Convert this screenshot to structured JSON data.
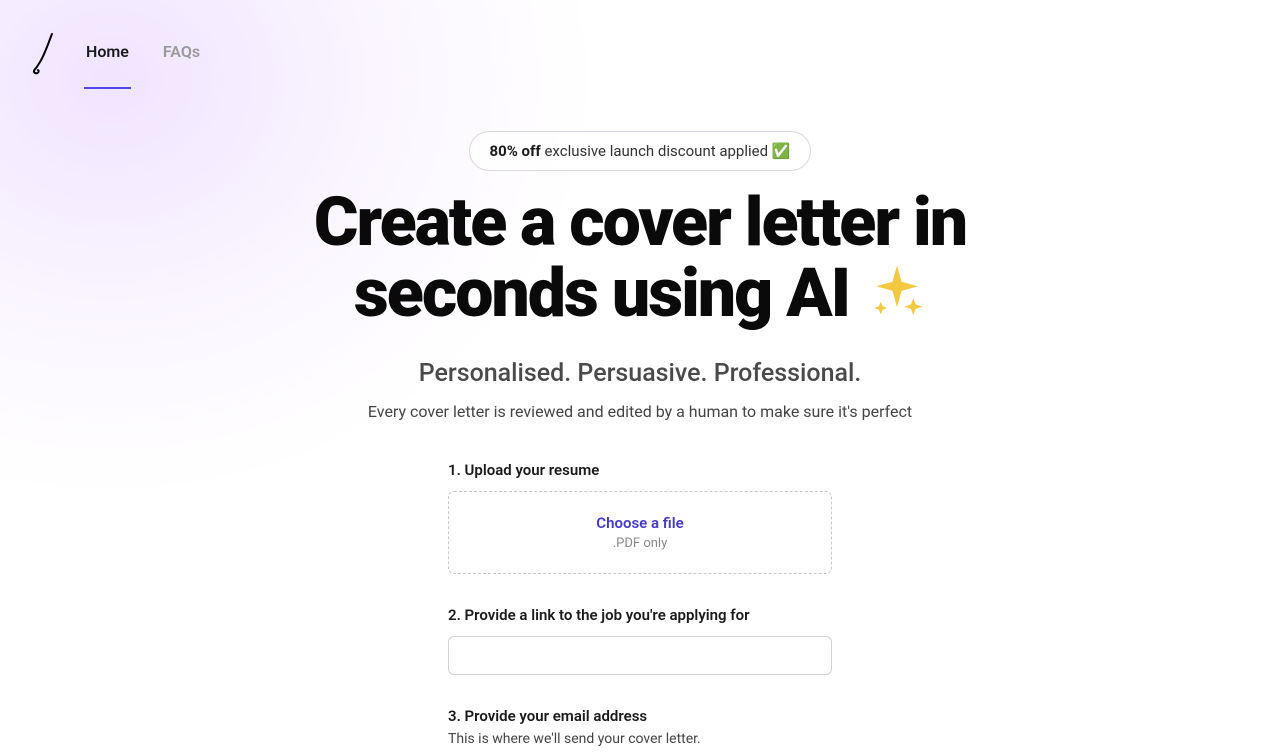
{
  "nav": {
    "home": "Home",
    "faqs": "FAQs"
  },
  "discount": {
    "bold": "80% off",
    "rest": " exclusive launch discount applied ✅"
  },
  "hero": {
    "title_prefix": "Create a cover letter in seconds using AI ",
    "subtitle": "Personalised. Persuasive. Professional.",
    "tagline": "Every cover letter is reviewed and edited by a human to make sure it's perfect"
  },
  "form": {
    "step1": {
      "label": "1. Upload your resume",
      "choose": "Choose a file",
      "hint": ".PDF only"
    },
    "step2": {
      "label": "2. Provide a link to the job you're applying for",
      "value": ""
    },
    "step3": {
      "label": "3. Provide your email address",
      "helper": "This is where we'll send your cover letter."
    }
  }
}
